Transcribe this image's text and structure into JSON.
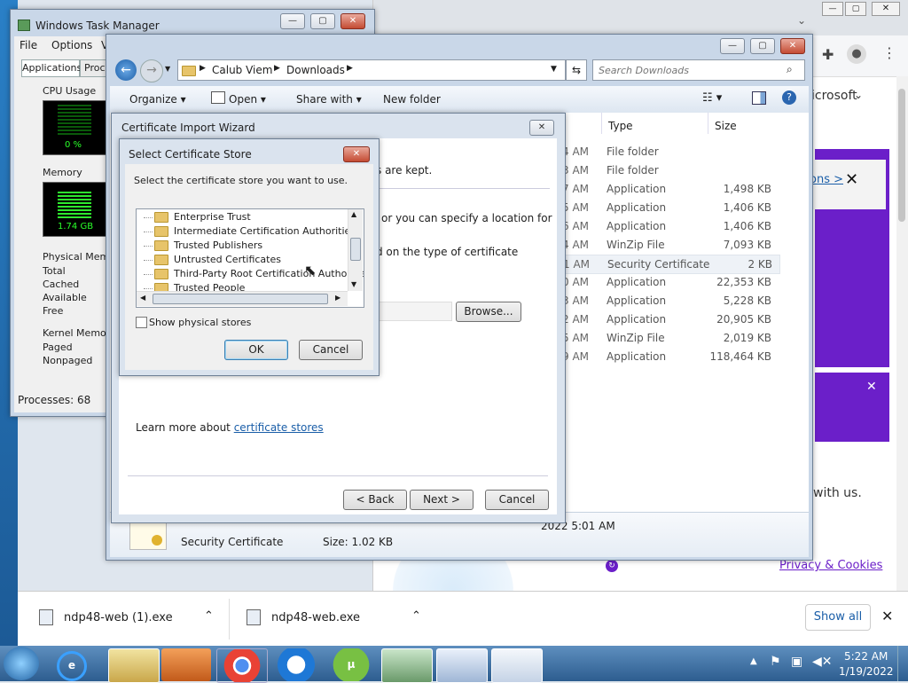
{
  "taskmgr": {
    "title": "Windows Task Manager",
    "menu": [
      "File",
      "Options",
      "V"
    ],
    "tabs": [
      "Applications",
      "Proc"
    ],
    "cpu_label": "CPU Usage",
    "cpu_value": "0 %",
    "memory_label": "Memory",
    "memory_value": "1.74 GB",
    "physical_label": "Physical Memor",
    "physical_rows": [
      "Total",
      "Cached",
      "Available",
      "Free"
    ],
    "kernel_label": "Kernel Memory",
    "kernel_rows": [
      "Paged",
      "Nonpaged"
    ],
    "processes": "Processes: 68"
  },
  "explorer": {
    "path": [
      "Calub Viem",
      "Downloads"
    ],
    "search_placeholder": "Search Downloads",
    "toolbar": {
      "organize": "Organize",
      "open": "Open",
      "share": "Share with",
      "new_folder": "New folder"
    },
    "columns": {
      "type": "Type",
      "size": "Size"
    },
    "files": [
      {
        "time": "4 AM",
        "type": "File folder",
        "size": ""
      },
      {
        "time": "3 AM",
        "type": "File folder",
        "size": ""
      },
      {
        "time": "7 AM",
        "type": "Application",
        "size": "1,498 KB"
      },
      {
        "time": "5 AM",
        "type": "Application",
        "size": "1,406 KB"
      },
      {
        "time": "6 AM",
        "type": "Application",
        "size": "1,406 KB"
      },
      {
        "time": "4 AM",
        "type": "WinZip File",
        "size": "7,093 KB"
      },
      {
        "time": "1 AM",
        "type": "Security Certificate",
        "size": "2 KB"
      },
      {
        "time": "0 AM",
        "type": "Application",
        "size": "22,353 KB"
      },
      {
        "time": "3 AM",
        "type": "Application",
        "size": "5,228 KB"
      },
      {
        "time": "2 AM",
        "type": "Application",
        "size": "20,905 KB"
      },
      {
        "time": "5 AM",
        "type": "WinZip File",
        "size": "2,019 KB"
      },
      {
        "time": "9 AM",
        "type": "Application",
        "size": "118,464 KB"
      }
    ],
    "details_date": "2022 5:01 AM",
    "details_type": "Security Certificate",
    "details_size": "Size: 1.02 KB"
  },
  "wizard": {
    "title": "Certificate Import Wizard",
    "text1": "s are kept.",
    "text2": "or you can specify a location for",
    "text3": "d on the type of certificate",
    "browse": "Browse...",
    "learn_prefix": "Learn more about ",
    "learn_link": "certificate stores",
    "back": "< Back",
    "next": "Next >",
    "cancel": "Cancel"
  },
  "store_dialog": {
    "title": "Select Certificate Store",
    "prompt": "Select the certificate store you want to use.",
    "stores": [
      "Enterprise Trust",
      "Intermediate Certification Authorities",
      "Trusted Publishers",
      "Untrusted Certificates",
      "Third-Party Root Certification Authorities",
      "Trusted People"
    ],
    "show_physical": "Show physical stores",
    "ok": "OK",
    "cancel": "Cancel"
  },
  "browser": {
    "microsoft_text": "icrosoft",
    "banner_link": "ons >",
    "with_us": "with us.",
    "privacy": "Privacy & Cookies"
  },
  "downloads": {
    "items": [
      "ndp48-web (1).exe",
      "ndp48-web.exe"
    ],
    "show_all": "Show all"
  },
  "taskbar": {
    "time": "5:22 AM",
    "date": "1/19/2022"
  },
  "colors": {
    "accent_purple": "#6b1fc9",
    "link_blue": "#1a5ea8"
  }
}
